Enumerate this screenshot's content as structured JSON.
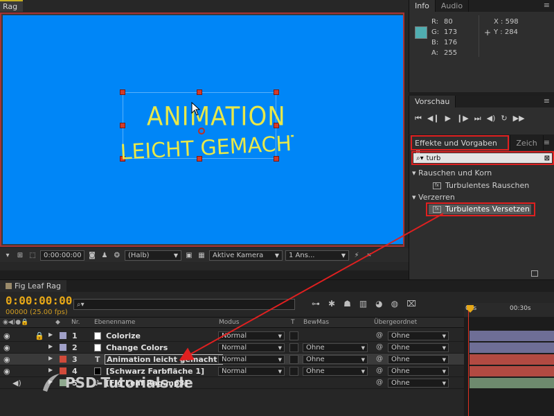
{
  "viewer": {
    "tab_label": "Rag",
    "canvas_text_line1": "ANIMATION",
    "canvas_text_line2": "LEICHT GEMACHT!",
    "toolbar": {
      "timecode": "0:00:00:00",
      "resolution": "(Halb)",
      "camera": "Aktive Kamera",
      "views": "1 Ans..."
    }
  },
  "info_panel": {
    "tabs": [
      "Info",
      "Audio"
    ],
    "r_label": "R:",
    "r_value": "80",
    "g_label": "G:",
    "g_value": "173",
    "b_label": "B:",
    "b_value": "176",
    "a_label": "A:",
    "a_value": "255",
    "x_readout": "X : 598",
    "y_readout": "Y : 284",
    "swatch_color": "#50adb0"
  },
  "preview_panel": {
    "tab": "Vorschau"
  },
  "effects_panel": {
    "tab": "Effekte und Vorgaben",
    "tab2": "Zeich",
    "search_value": "turb",
    "categories": [
      {
        "name": "Rauschen und Korn",
        "items": [
          "Turbulentes Rauschen"
        ]
      },
      {
        "name": "Verzerren",
        "items": [
          "Turbulentes Versetzen"
        ]
      }
    ]
  },
  "timeline": {
    "tab": "Fig Leaf Rag",
    "timecode": "0:00:00:00",
    "fps": "00000 (25.00 fps)",
    "ruler_start": "00s",
    "ruler_mark": "00:30s",
    "columns": {
      "nr": "Nr.",
      "name": "Ebenenname",
      "mode": "Modus",
      "t": "T",
      "trkmat": "BewMas",
      "parent": "Übergeordnet"
    },
    "layers": [
      {
        "num": "1",
        "name": "Colorize",
        "mode": "Normal",
        "trkmat": "",
        "parent": "Ohne",
        "label": "#a0a0c8",
        "bar": "#6e6e96"
      },
      {
        "num": "2",
        "name": "Change Colors",
        "mode": "Normal",
        "trkmat": "Ohne",
        "parent": "Ohne",
        "label": "#a0a0c8",
        "bar": "#6e6e96"
      },
      {
        "num": "3",
        "name": "Animation leicht gemacht!",
        "mode": "Normal",
        "trkmat": "Ohne",
        "parent": "Ohne",
        "label": "#d04a3a",
        "bar": "#b24a42"
      },
      {
        "num": "4",
        "name": "[Schwarz Farbfläche 1]",
        "mode": "Normal",
        "trkmat": "Ohne",
        "parent": "Ohne",
        "label": "#d04a3a",
        "bar": "#b24a42"
      },
      {
        "num": "5",
        "name": "[Fig Leaf Rag.mp3]",
        "mode": "",
        "trkmat": "",
        "parent": "Ohne",
        "label": "#8ea88e",
        "bar": "#6e8a6e"
      }
    ]
  },
  "watermark": "PSD-Tutorials.de",
  "colors": {
    "canvas": "#0086f7",
    "text": "#e8e84a",
    "highlight": "#e02020",
    "timecode": "#e6a717"
  }
}
